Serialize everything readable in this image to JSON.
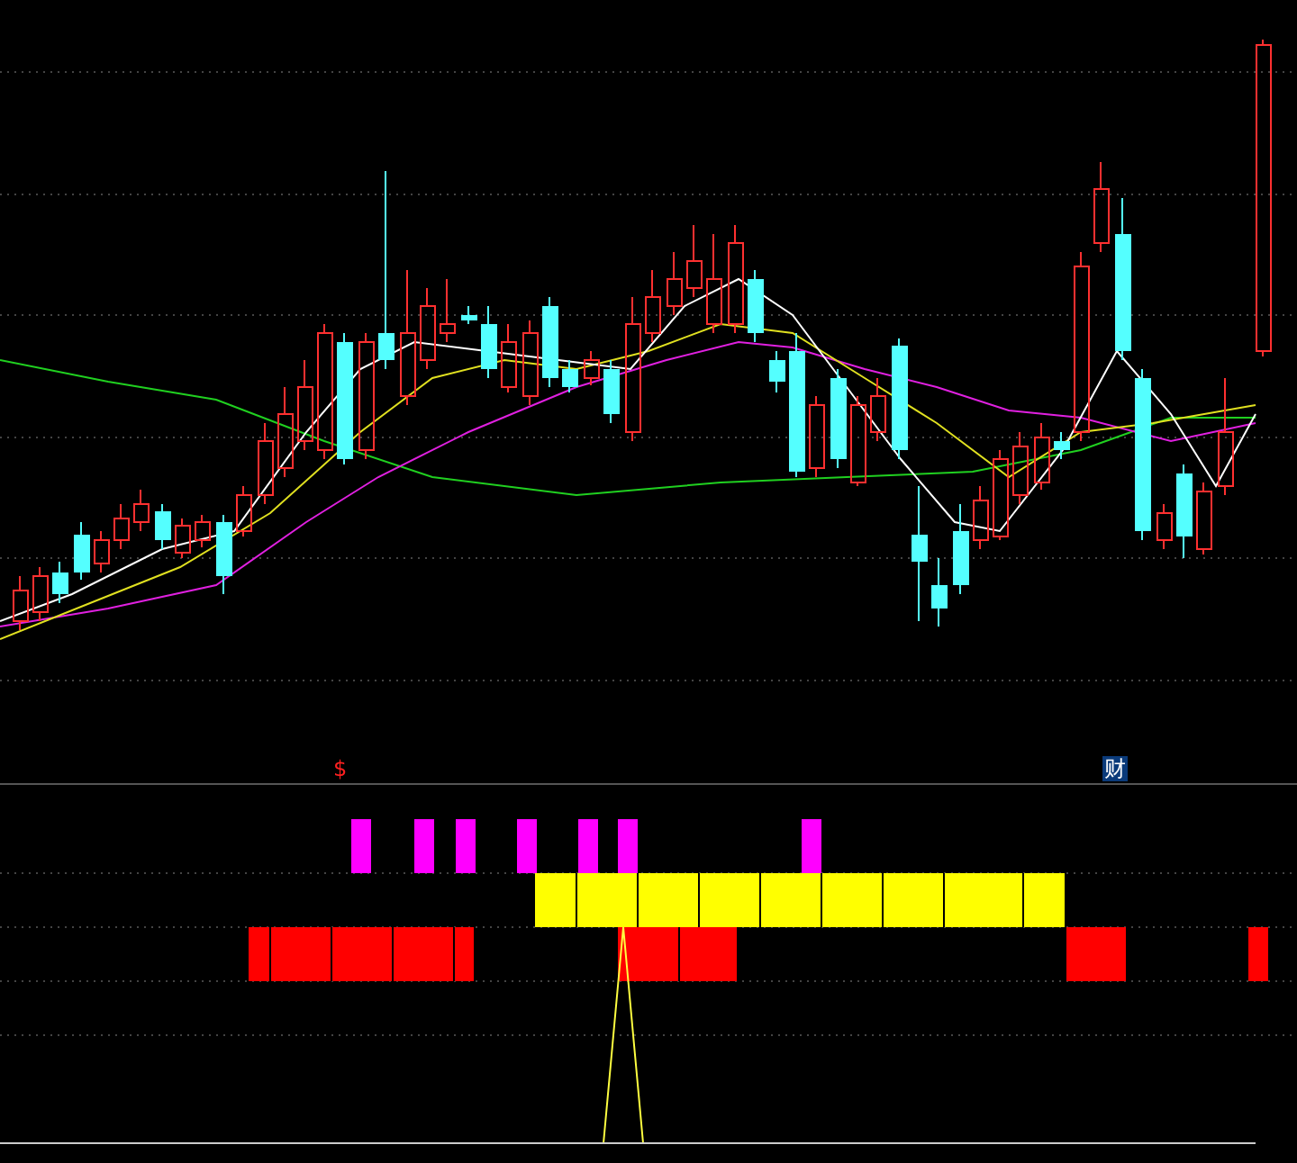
{
  "signal_markers": [
    {
      "text": "$",
      "kind": "dollar"
    },
    {
      "text": "财",
      "kind": "finance"
    }
  ]
}
